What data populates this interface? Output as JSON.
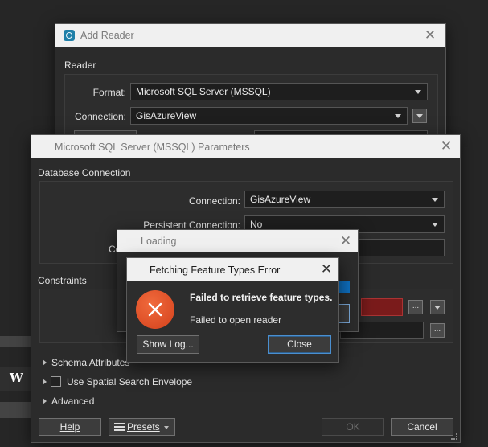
{
  "background": {
    "toolbar_glyph": "W"
  },
  "add_reader": {
    "title": "Add Reader",
    "section_reader": "Reader",
    "format_label": "Format:",
    "format_value": "Microsoft SQL Server (MSSQL)",
    "connection_label": "Connection:",
    "connection_value": "GisAzureView"
  },
  "params": {
    "title": "Microsoft SQL Server (MSSQL) Parameters",
    "section_db": "Database Connection",
    "connection_label": "Connection:",
    "connection_value": "GisAzureView",
    "persistent_label": "Persistent Connection:",
    "persistent_value": "No",
    "partial_label": "Co",
    "section_constraints": "Constraints",
    "schema_attributes": "Schema Attributes",
    "use_spatial": "Use Spatial Search Envelope",
    "advanced": "Advanced",
    "help_button": "Help",
    "presets_button": "Presets",
    "ok_button": "OK",
    "cancel_button": "Cancel",
    "ellipsis": "..."
  },
  "loading": {
    "title": "Loading"
  },
  "error_dialog": {
    "title": "Fetching Feature Types Error",
    "heading": "Failed to retrieve feature types.",
    "message": "Failed to open reader",
    "show_log_button": "Show Log...",
    "close_button": "Close",
    "icon": "error-x-icon"
  },
  "colors": {
    "accent_blue": "#0e6fbf",
    "error_orange": "#e0522a",
    "constraint_red": "#7a1b1b"
  }
}
